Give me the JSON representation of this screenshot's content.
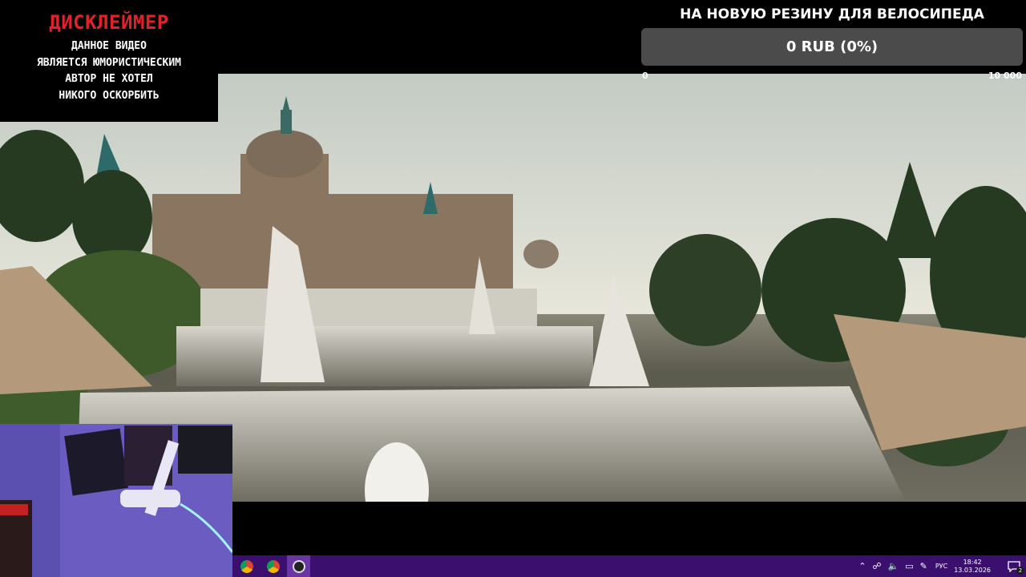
{
  "disclaimer": {
    "title": "ДИСКЛЕЙМЕР",
    "lines": [
      "ДАННОЕ ВИДЕО",
      "ЯВЛЯЕТСЯ ЮМОРИСТИЧЕСКИМ",
      "АВТОР НЕ ХОТЕЛ",
      "НИКОГО ОСКОРБИТЬ"
    ],
    "title_color": "#e1222a"
  },
  "goal": {
    "title": "НА НОВУЮ РЕЗИНУ ДЛЯ ВЕЛОСИПЕДА",
    "value": "0 RUB (0%)",
    "progress": 0,
    "min_label": "0",
    "max_label": "10 000"
  },
  "taskbar": {
    "apps": [
      {
        "name": "chrome-icon",
        "active": false
      },
      {
        "name": "chrome-icon",
        "active": false
      },
      {
        "name": "obs-icon",
        "active": true
      }
    ],
    "tray": {
      "language": "РУС",
      "time": "18:42",
      "date": "13.03.2026",
      "notifications": "2"
    },
    "color": "#3a0f6e"
  }
}
